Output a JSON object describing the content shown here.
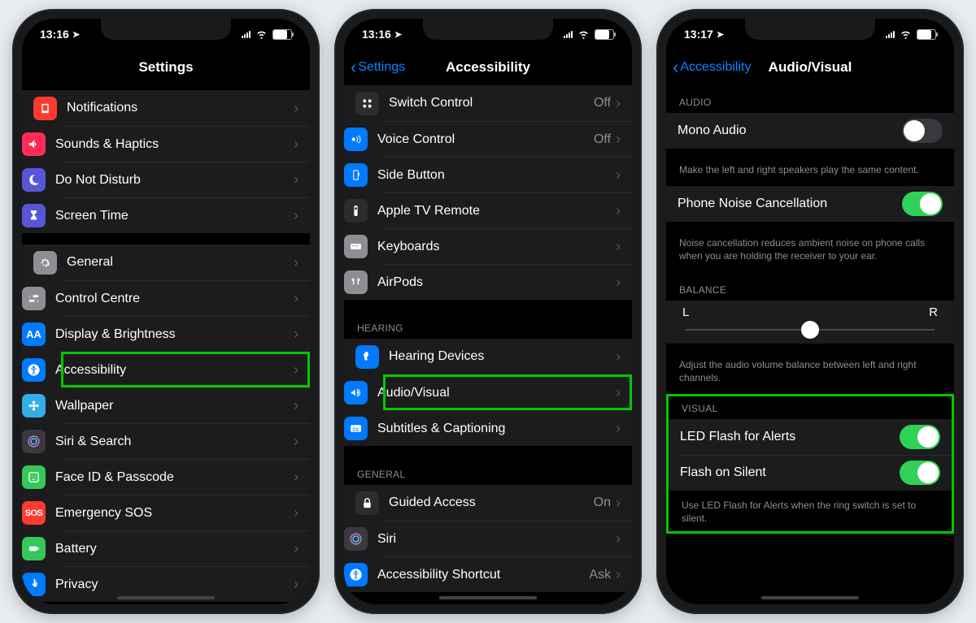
{
  "status": {
    "time1": "13:16",
    "time2": "13:16",
    "time3": "13:17"
  },
  "phone1": {
    "title": "Settings",
    "groupA": [
      {
        "icon": "ic-red",
        "glyph": "notif",
        "label": "Notifications"
      },
      {
        "icon": "ic-pink",
        "glyph": "sound",
        "label": "Sounds & Haptics"
      },
      {
        "icon": "ic-purple",
        "glyph": "moon",
        "label": "Do Not Disturb"
      },
      {
        "icon": "ic-purple",
        "glyph": "hourglass",
        "label": "Screen Time"
      }
    ],
    "groupB": [
      {
        "icon": "ic-grey",
        "glyph": "gear",
        "label": "General"
      },
      {
        "icon": "ic-grey",
        "glyph": "switches",
        "label": "Control Centre"
      },
      {
        "icon": "ic-blue",
        "glyph": "AA",
        "label": "Display & Brightness"
      },
      {
        "icon": "ic-blue",
        "glyph": "access",
        "label": "Accessibility",
        "highlight": true
      },
      {
        "icon": "ic-teal",
        "glyph": "flower",
        "label": "Wallpaper"
      },
      {
        "icon": "ic-dark",
        "glyph": "siri",
        "label": "Siri & Search"
      },
      {
        "icon": "ic-green",
        "glyph": "face",
        "label": "Face ID & Passcode"
      },
      {
        "icon": "ic-red",
        "glyph": "SOS",
        "label": "Emergency SOS"
      },
      {
        "icon": "ic-green",
        "glyph": "batt",
        "label": "Battery"
      },
      {
        "icon": "ic-blue",
        "glyph": "hand",
        "label": "Privacy"
      }
    ]
  },
  "phone2": {
    "title": "Accessibility",
    "back": "Settings",
    "groupTop": [
      {
        "icon": "ic-darker",
        "glyph": "grid",
        "label": "Switch Control",
        "value": "Off"
      },
      {
        "icon": "ic-blue",
        "glyph": "voice",
        "label": "Voice Control",
        "value": "Off"
      },
      {
        "icon": "ic-blue",
        "glyph": "sidebtn",
        "label": "Side Button"
      },
      {
        "icon": "ic-darker",
        "glyph": "remote",
        "label": "Apple TV Remote"
      },
      {
        "icon": "ic-grey",
        "glyph": "keyboard",
        "label": "Keyboards"
      },
      {
        "icon": "ic-grey",
        "glyph": "airpods",
        "label": "AirPods"
      }
    ],
    "hearingHeader": "Hearing",
    "hearing": [
      {
        "icon": "ic-blue",
        "glyph": "ear",
        "label": "Hearing Devices"
      },
      {
        "icon": "ic-blue",
        "glyph": "audio",
        "label": "Audio/Visual",
        "highlight": true
      },
      {
        "icon": "ic-blue",
        "glyph": "cc",
        "label": "Subtitles & Captioning"
      }
    ],
    "generalHeader": "General",
    "general": [
      {
        "icon": "ic-darker",
        "glyph": "lock",
        "label": "Guided Access",
        "value": "On"
      },
      {
        "icon": "ic-dark",
        "glyph": "siri",
        "label": "Siri"
      },
      {
        "icon": "ic-blue",
        "glyph": "access",
        "label": "Accessibility Shortcut",
        "value": "Ask"
      }
    ]
  },
  "phone3": {
    "title": "Audio/Visual",
    "back": "Accessibility",
    "audioHeader": "Audio",
    "mono": {
      "label": "Mono Audio",
      "on": false
    },
    "monoFoot": "Make the left and right speakers play the same content.",
    "noise": {
      "label": "Phone Noise Cancellation",
      "on": true
    },
    "noiseFoot": "Noise cancellation reduces ambient noise on phone calls when you are holding the receiver to your ear.",
    "balanceHeader": "Balance",
    "balanceL": "L",
    "balanceR": "R",
    "balanceFoot": "Adjust the audio volume balance between left and right channels.",
    "visualHeader": "Visual",
    "led": {
      "label": "LED Flash for Alerts",
      "on": true
    },
    "flashSilent": {
      "label": "Flash on Silent",
      "on": true
    },
    "visualFoot": "Use LED Flash for Alerts when the ring switch is set to silent."
  }
}
